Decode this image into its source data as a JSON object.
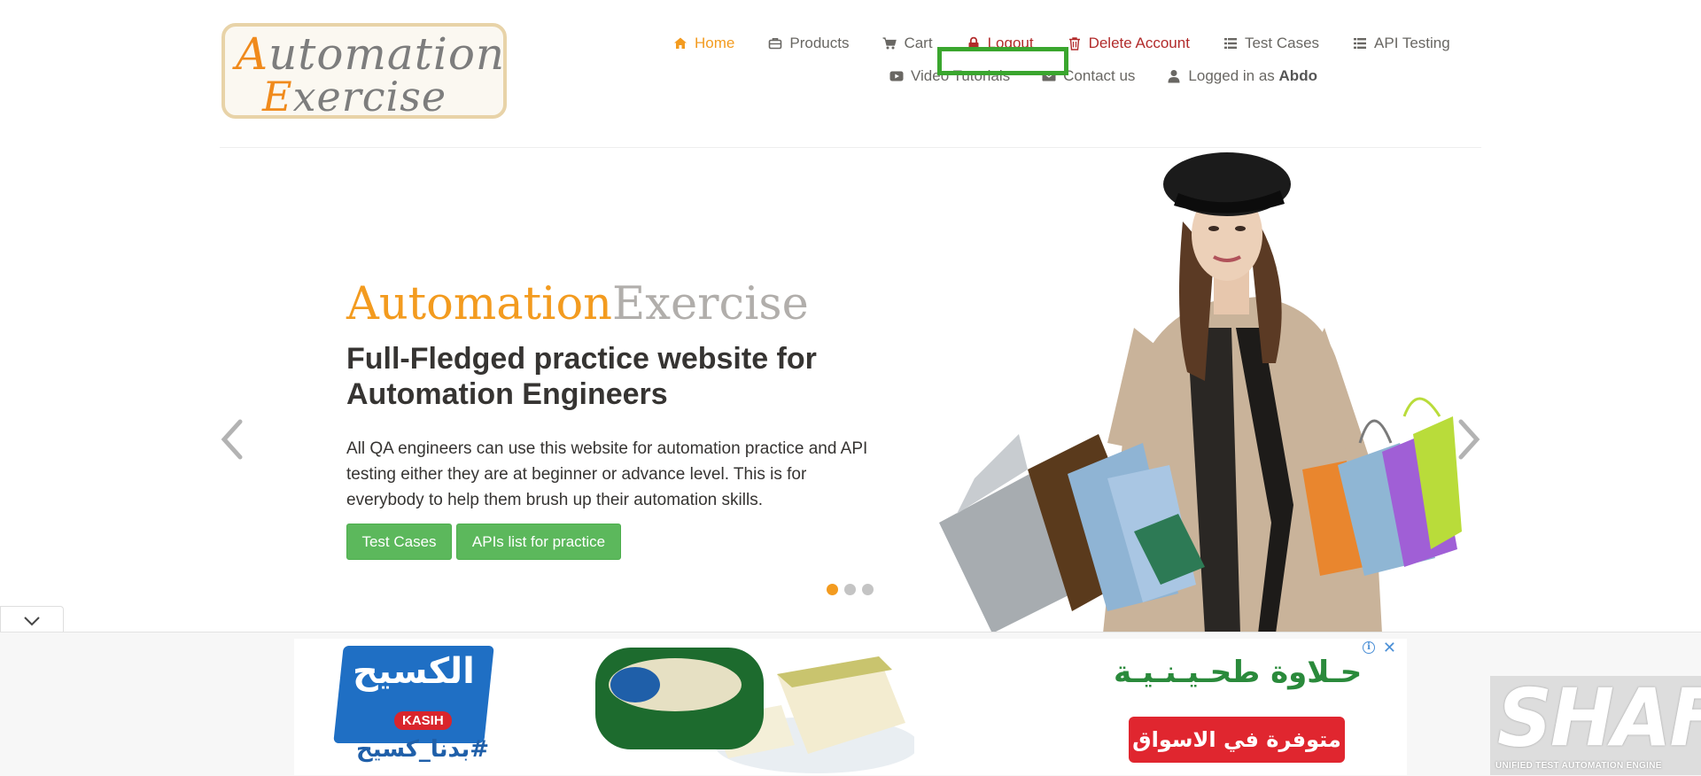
{
  "logo": {
    "line1_cap": "A",
    "line1_rest": "utomation",
    "line2_cap": "E",
    "line2_rest": "xercise"
  },
  "nav": {
    "home": "Home",
    "products": "Products",
    "cart": "Cart",
    "logout": "Logout",
    "delete_account": "Delete Account",
    "test_cases": "Test Cases",
    "api_testing": "API Testing",
    "video_tutorials": "Video Tutorials",
    "contact_us": "Contact us",
    "logged_in_prefix": "Logged in as",
    "logged_in_user": "Abdo"
  },
  "slider": {
    "brand_part1": "Automation",
    "brand_part2": "Exercise",
    "headline": "Full-Fledged practice website for Automation Engineers",
    "description": "All QA engineers can use this website for automation practice and API testing either they are at beginner or advance level. This is for everybody to help them brush up their automation skills.",
    "btn_test_cases": "Test Cases",
    "btn_apis": "APIs list for practice",
    "active_slide": 1,
    "slide_count": 3
  },
  "ad": {
    "kasih_arabic": "الكسيح",
    "kasih_english": "KASIH",
    "kasih_hashtag": "#بدنا_كسيح",
    "halva_title": "حـلاوة طحـيـنـيـة",
    "halva_button": "متوفرة في الاسواق",
    "info_icon": "info-icon",
    "close_icon": "close-icon"
  },
  "watermark": {
    "word": "SHAFT",
    "subtitle": "UNIFIED TEST AUTOMATION ENGINE"
  },
  "colors": {
    "accent": "#f39b1f",
    "button_green": "#5cb85c",
    "danger": "#b22b2b",
    "highlight_box": "#3aa62e"
  }
}
